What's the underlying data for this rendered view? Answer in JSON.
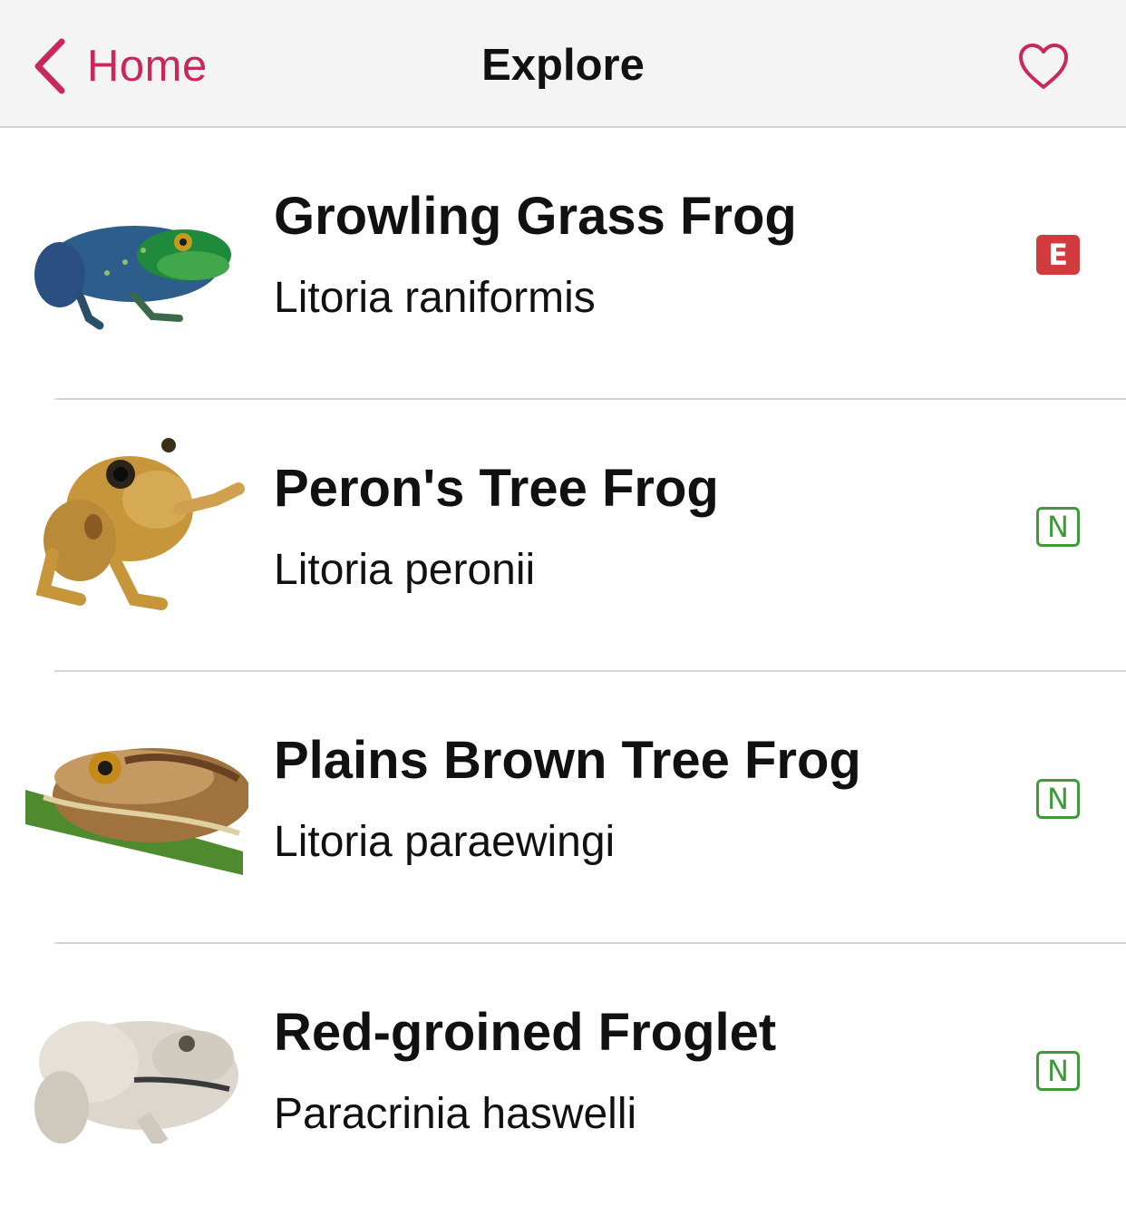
{
  "navbar": {
    "back_label": "Home",
    "title": "Explore",
    "back_icon": "chevron-left-icon",
    "favourite_icon": "heart-outline-icon",
    "accent_color": "#c8285a"
  },
  "species": [
    {
      "common_name": "Growling Grass Frog",
      "scientific_name": "Litoria raniformis",
      "status_badge": "E",
      "status_color": "#d13b3b"
    },
    {
      "common_name": "Peron's Tree Frog",
      "scientific_name": "Litoria peronii",
      "status_badge": "N",
      "status_color": "#3f9a3a"
    },
    {
      "common_name": "Plains Brown Tree Frog",
      "scientific_name": "Litoria paraewingi",
      "status_badge": "N",
      "status_color": "#3f9a3a"
    },
    {
      "common_name": "Red-groined Froglet",
      "scientific_name": "Paracrinia haswelli",
      "status_badge": "N",
      "status_color": "#3f9a3a"
    }
  ]
}
